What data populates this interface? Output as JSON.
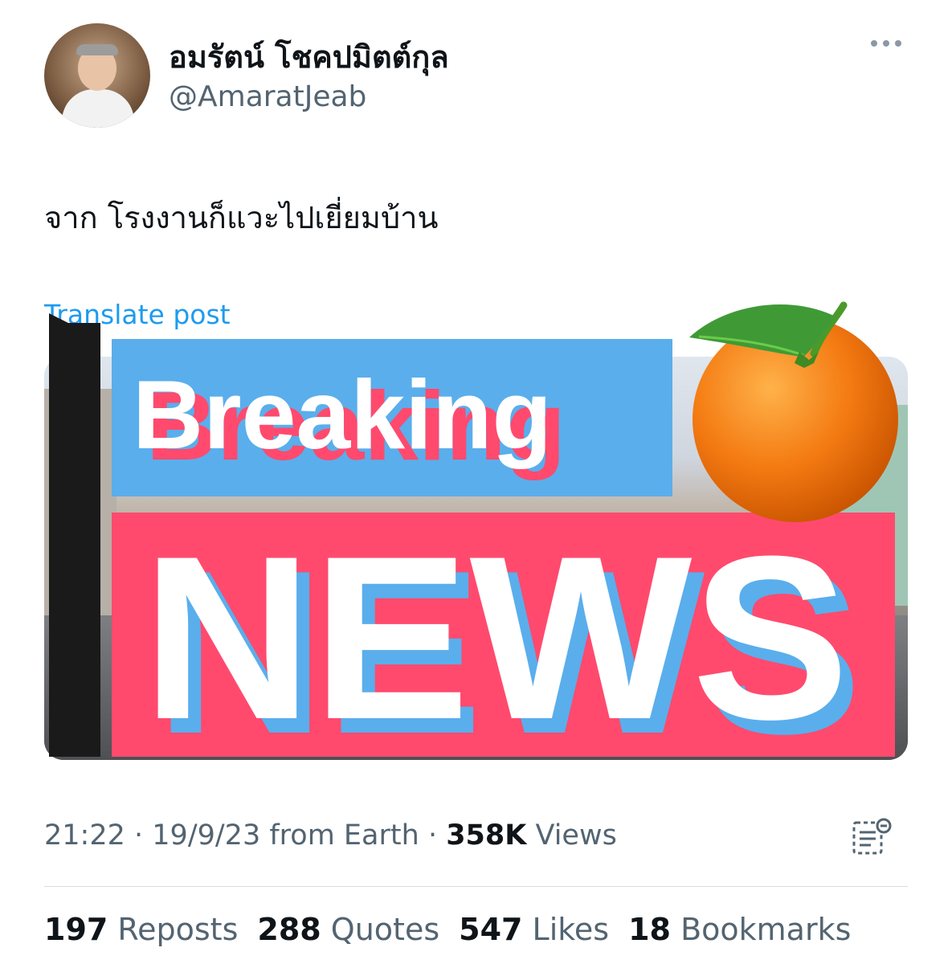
{
  "author": {
    "name": "อมรัตน์ โชคปมิตต์กุล",
    "handle": "@AmaratJeab"
  },
  "tweet": {
    "text": "จาก โรงงานก็แวะไปเยี่ยมบ้าน",
    "translate_label": "Translate post",
    "sticker_top": "Breaking",
    "sticker_bottom": "NEWS"
  },
  "meta": {
    "time": "21:22",
    "date": "19/9/23",
    "source": "from Earth",
    "views_count": "358K",
    "views_label": "Views"
  },
  "stats": [
    {
      "count": "197",
      "label": "Reposts"
    },
    {
      "count": "288",
      "label": "Quotes"
    },
    {
      "count": "547",
      "label": "Likes"
    },
    {
      "count": "18",
      "label": "Bookmarks"
    }
  ],
  "colors": {
    "blue_banner": "#5aaeec",
    "red_banner": "#ff4a6e",
    "link": "#1d9bf0",
    "muted": "#536471"
  },
  "icons": {
    "more": "more-horizontal-icon",
    "analytics": "analytics-icon",
    "sticker_fruit": "orange-fruit-icon"
  }
}
